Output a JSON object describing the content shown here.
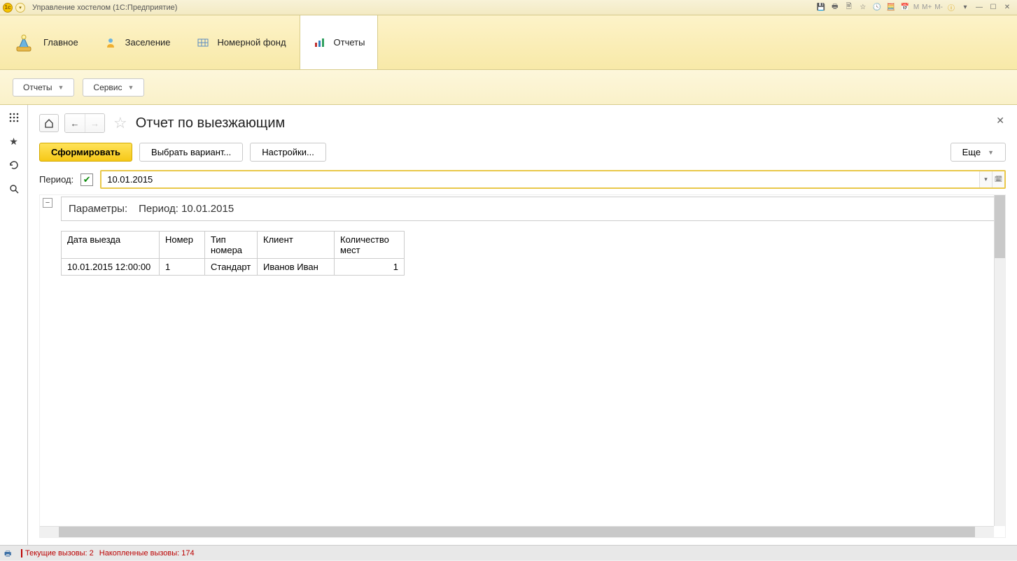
{
  "titlebar": {
    "title": "Управление хостелом  (1С:Предприятие)",
    "m_labels": [
      "M",
      "M+",
      "M-"
    ]
  },
  "mainnav": {
    "items": [
      {
        "label": "Главное"
      },
      {
        "label": "Заселение"
      },
      {
        "label": "Номерной фонд"
      },
      {
        "label": "Отчеты"
      }
    ]
  },
  "subbar": {
    "reports": "Отчеты",
    "service": "Сервис"
  },
  "page": {
    "title": "Отчет по выезжающим"
  },
  "actions": {
    "generate": "Сформировать",
    "choose_variant": "Выбрать вариант...",
    "settings": "Настройки...",
    "more": "Еще"
  },
  "period": {
    "label": "Период:",
    "value": "10.01.2015"
  },
  "report": {
    "params_label": "Параметры:",
    "params_value": "Период: 10.01.2015",
    "columns": [
      "Дата выезда",
      "Номер",
      "Тип номера",
      "Клиент",
      "Количество мест"
    ],
    "rows": [
      {
        "date": "10.01.2015 12:00:00",
        "number": "1",
        "type": "Стандарт",
        "client": "Иванов Иван",
        "places": "1"
      }
    ]
  },
  "status": {
    "current": "Текущие вызовы: 2",
    "accum": "Накопленные вызовы: 174"
  }
}
